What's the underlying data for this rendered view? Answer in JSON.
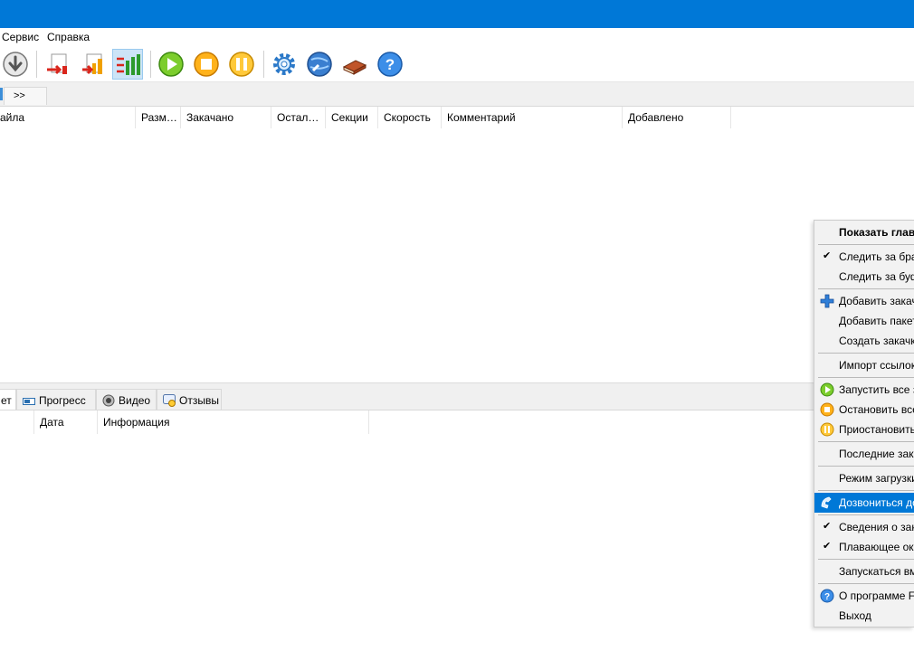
{
  "menubar": {
    "items": [
      "Сервис",
      "Справка"
    ]
  },
  "toolbar": {
    "buttons": [
      {
        "icon": "download-arrow-icon",
        "active": false
      },
      {
        "icon": "priority-low-icon",
        "active": false
      },
      {
        "icon": "priority-medium-icon",
        "active": false
      },
      {
        "icon": "priority-high-icon",
        "active": true
      },
      {
        "icon": "start-all-icon",
        "active": false
      },
      {
        "icon": "stop-all-icon",
        "active": false
      },
      {
        "icon": "pause-all-icon",
        "active": false
      },
      {
        "icon": "settings-gear-icon",
        "active": false
      },
      {
        "icon": "dial-up-globe-icon",
        "active": false
      },
      {
        "icon": "book-icon",
        "active": false
      },
      {
        "icon": "help-icon",
        "active": false
      }
    ]
  },
  "tabs": {
    "more_label": ">>"
  },
  "downloads_table": {
    "columns": [
      "айла",
      "Разм…",
      "Закачано",
      "Остал…",
      "Секции",
      "Скорость",
      "Комментарий",
      "Добавлено"
    ]
  },
  "bottom_tabs": [
    "ет",
    "Прогресс",
    "Видео",
    "Отзывы"
  ],
  "log_table": {
    "columns": [
      "Дата",
      "Информация"
    ]
  },
  "context_menu": {
    "items": [
      {
        "label": "Показать главн",
        "bold": true
      },
      {
        "label": "Следить за брау",
        "check": true
      },
      {
        "label": "Следить за буфе"
      },
      {
        "label": "Добавить закач",
        "icon": "add-plus-icon"
      },
      {
        "label": "Добавить пакет"
      },
      {
        "label": "Создать закачку"
      },
      {
        "label": "Импорт ссылок"
      },
      {
        "label": "Запустить все з",
        "icon": "start-all-icon"
      },
      {
        "label": "Остановить все",
        "icon": "stop-all-icon"
      },
      {
        "label": "Приостановить",
        "icon": "pause-all-icon"
      },
      {
        "label": "Последние закач"
      },
      {
        "label": "Режим загрузки"
      },
      {
        "label": "Дозвониться до",
        "icon": "phone-icon",
        "highlighted": true
      },
      {
        "label": "Сведения о зак",
        "check": true
      },
      {
        "label": "Плавающее окн",
        "check": true
      },
      {
        "label": "Запускаться вме"
      },
      {
        "label": "О программе F",
        "icon": "help-icon"
      },
      {
        "label": "Выход"
      }
    ]
  },
  "colors": {
    "titlebar": "#0078d7",
    "highlight": "#0078d7"
  }
}
